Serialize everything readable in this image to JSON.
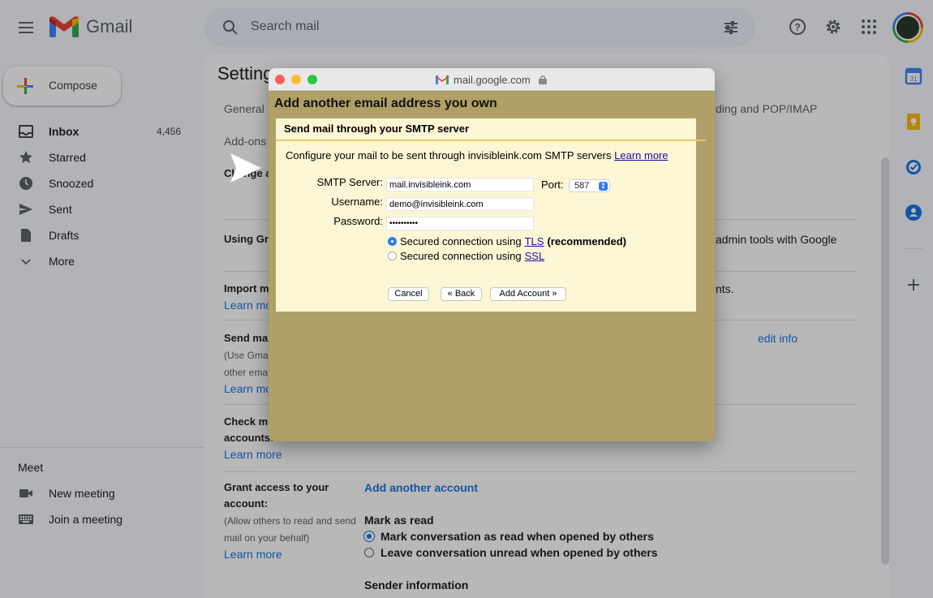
{
  "topbar": {
    "app_name": "Gmail",
    "search_placeholder": "Search mail"
  },
  "nav": {
    "compose_label": "Compose",
    "items": [
      {
        "label": "Inbox",
        "count": "4,456",
        "icon": "inbox-icon"
      },
      {
        "label": "Starred",
        "icon": "star-icon"
      },
      {
        "label": "Snoozed",
        "icon": "clock-icon"
      },
      {
        "label": "Sent",
        "icon": "send-icon"
      },
      {
        "label": "Drafts",
        "icon": "draft-icon"
      },
      {
        "label": "More",
        "icon": "chevron-down-icon"
      }
    ],
    "meet_title": "Meet",
    "meet_items": [
      {
        "label": "New meeting",
        "icon": "video-icon"
      },
      {
        "label": "Join a meeting",
        "icon": "keyboard-icon"
      }
    ]
  },
  "settings": {
    "title": "Settings",
    "tab_general": "General",
    "tab_forwarding": "ding and POP/IMAP",
    "tab_addons": "Add-ons",
    "sec_change": "Change a",
    "sec_using": "Using Gr",
    "sec_using_right": "admin tools with Google",
    "sec_import": "Import m",
    "sec_import_right": "nts.",
    "learn_more_import": "Learn mo",
    "sec_send": "Send ma",
    "sec_send_sub1": "(Use Gma",
    "sec_send_sub2": "other ema",
    "learn_more_send": "Learn mo",
    "edit_info": "edit info",
    "sec_check1": "Check m",
    "sec_check2": "accounts:",
    "learn_more_check": "Learn more",
    "grant_title1": "Grant access to your",
    "grant_title2": "account:",
    "grant_sub1": "(Allow others to read and send",
    "grant_sub2": "mail on your behalf)",
    "learn_more_grant": "Learn more",
    "add_another_account": "Add another account",
    "mark_as_read": "Mark as read",
    "mark_option_1": "Mark conversation as read when opened by others",
    "mark_option_2": "Leave conversation unread when opened by others",
    "sender_information": "Sender information"
  },
  "popup": {
    "window_title": "mail.google.com",
    "heading": "Add another email address you own",
    "panel_title": "Send mail through your SMTP server",
    "description": "Configure your mail to be sent through invisibleink.com SMTP servers",
    "description_link": "Learn more",
    "smtp_label": "SMTP Server:",
    "smtp_value": "mail.invisibleink.com",
    "port_label": "Port:",
    "port_value": "587",
    "username_label": "Username:",
    "username_value": "demo@invisibleink.com",
    "password_label": "Password:",
    "password_value": "••••••••••",
    "tls_prefix": "Secured connection using",
    "tls_link": "TLS",
    "tls_suffix": "(recommended)",
    "ssl_prefix": "Secured connection using",
    "ssl_link": "SSL",
    "cancel_label": "Cancel",
    "back_label": "« Back",
    "add_account_label": "Add Account »"
  },
  "colors": {
    "gmail_blue": "#1a73e8",
    "popup_bg": "#fdf6d5",
    "popup_frame": "#b09f66",
    "mac_red": "#fe5f57",
    "mac_yellow": "#febc2e",
    "mac_green": "#28c840"
  }
}
